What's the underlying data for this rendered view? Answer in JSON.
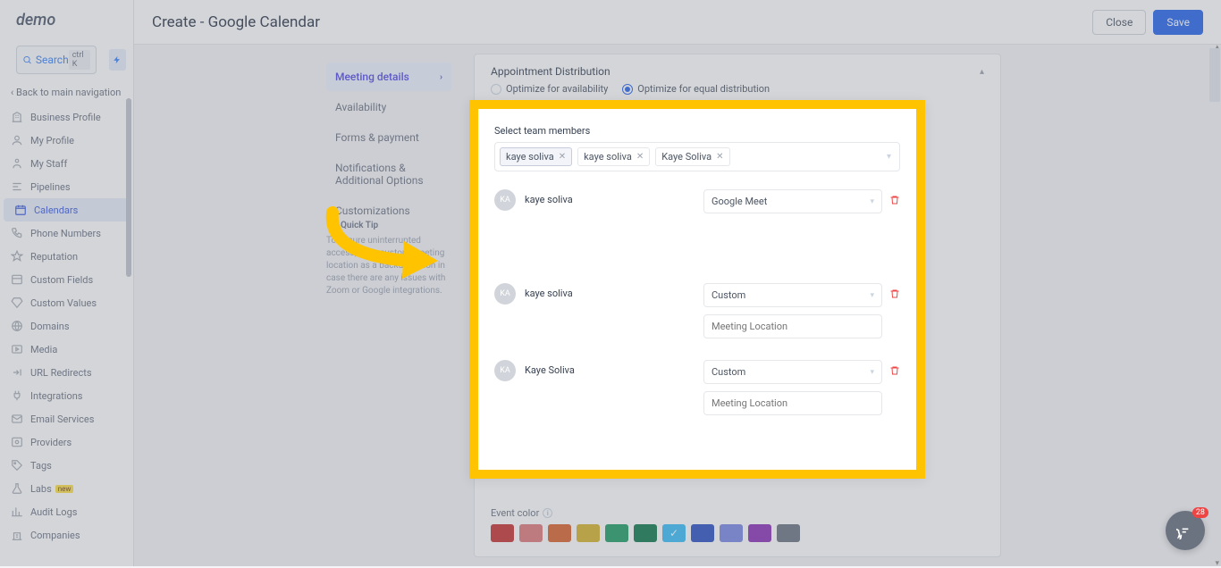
{
  "logo": "demo",
  "search": {
    "label": "Search",
    "shortcut": "ctrl K"
  },
  "back_nav": "Back to main navigation",
  "nav": [
    {
      "icon": "building",
      "label": "Business Profile"
    },
    {
      "icon": "user-circle",
      "label": "My Profile"
    },
    {
      "icon": "user",
      "label": "My Staff"
    },
    {
      "icon": "pipe",
      "label": "Pipelines"
    },
    {
      "icon": "calendar",
      "label": "Calendars",
      "active": true
    },
    {
      "icon": "phone",
      "label": "Phone Numbers"
    },
    {
      "icon": "star",
      "label": "Reputation"
    },
    {
      "icon": "field",
      "label": "Custom Fields"
    },
    {
      "icon": "gem",
      "label": "Custom Values"
    },
    {
      "icon": "globe",
      "label": "Domains"
    },
    {
      "icon": "media",
      "label": "Media"
    },
    {
      "icon": "redirect",
      "label": "URL Redirects"
    },
    {
      "icon": "plug",
      "label": "Integrations"
    },
    {
      "icon": "mail",
      "label": "Email Services"
    },
    {
      "icon": "provider",
      "label": "Providers"
    },
    {
      "icon": "tag",
      "label": "Tags"
    },
    {
      "icon": "flask",
      "label": "Labs",
      "badge": "new"
    },
    {
      "icon": "chart",
      "label": "Audit Logs"
    },
    {
      "icon": "bldg2",
      "label": "Companies"
    }
  ],
  "header": {
    "title": "Create - Google Calendar",
    "close": "Close",
    "save": "Save"
  },
  "subnav": [
    {
      "label": "Meeting details",
      "active": true
    },
    {
      "label": "Availability"
    },
    {
      "label": "Forms & payment"
    },
    {
      "label": "Notifications & Additional Options"
    },
    {
      "label": "Customizations"
    }
  ],
  "quick_tip": {
    "title": "Quick Tip",
    "body": "To ensure uninterrupted access, set a custom meeting location as a backup option in case there are any issues with Zoom or Google integrations."
  },
  "panel": {
    "dist_title": "Appointment Distribution",
    "radio_avail": "Optimize for availability",
    "radio_equal": "Optimize for equal distribution",
    "members_label": "Select team members",
    "chips": [
      "kaye soliva",
      "kaye soliva",
      "Kaye Soliva"
    ],
    "rows": [
      {
        "initials": "KA",
        "name": "kaye soliva",
        "select": "Google Meet"
      },
      {
        "initials": "KA",
        "name": "kaye soliva",
        "select": "Custom",
        "placeholder": "Meeting Location"
      },
      {
        "initials": "KA",
        "name": "Kaye Soliva",
        "select": "Custom",
        "placeholder": "Meeting Location"
      }
    ],
    "event_color": "Event color",
    "colors": [
      "#c53030",
      "#e07a7a",
      "#d9622b",
      "#d6b42a",
      "#1f9d61",
      "#0d7a4b",
      "#38bdf8",
      "#2b4fc0",
      "#7a86e3",
      "#8b2fb5",
      "#6b7280"
    ],
    "checked_idx": 6
  },
  "chat_count": "28"
}
